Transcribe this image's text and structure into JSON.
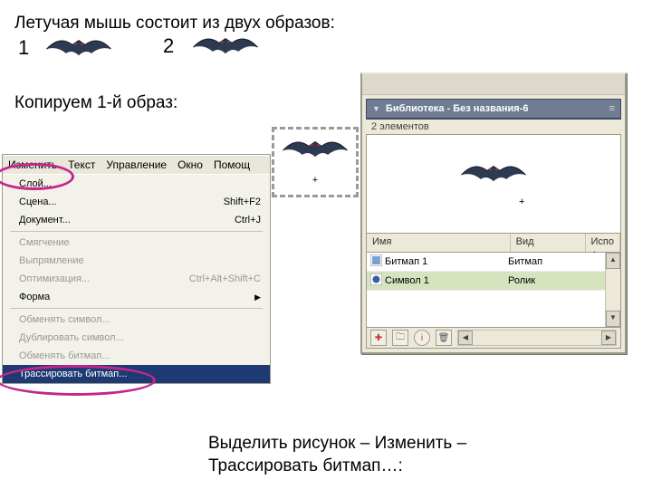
{
  "text": {
    "title_top": "Летучая мышь состоит из двух образов:",
    "num1": "1",
    "num2": "2",
    "copy_line": "Копируем 1-й образ:",
    "bottom1": "Выделить рисунок – Изменить –",
    "bottom2": "Трассировать битмап…:"
  },
  "menubar": {
    "edit": "Изменить",
    "text": "Текст",
    "uprav": "Управление",
    "okno": "Окно",
    "help": "Помощ"
  },
  "dropdown": {
    "sloi": "Слой...",
    "scena": "Сцена...",
    "scena_sc": "Shift+F2",
    "doc": "Документ...",
    "doc_sc": "Ctrl+J",
    "smyag": "Смягчение",
    "vypr": "Выпрямление",
    "opt": "Оптимизация...",
    "opt_sc": "Ctrl+Alt+Shift+C",
    "forma": "Форма",
    "obm_sym": "Обменять символ...",
    "dup_sym": "Дублировать символ...",
    "obm_bit": "Обменять битмап...",
    "trace": "Трассировать битмап..."
  },
  "library": {
    "title": "Библиотека - Без названия-6",
    "count": "2 элементов",
    "col_name": "Имя",
    "col_view": "Вид",
    "col_use": "Испо",
    "row1_name": "Битмап 1",
    "row1_type": "Битмап",
    "row2_name": "Символ 1",
    "row2_type": "Ролик",
    "icon_bitmap_color": "#7aa0d4",
    "icon_symbol_color": "#3a5fa8"
  },
  "colors": {
    "highlight": "#c4268a",
    "menu_sel": "#1d3a74",
    "panel": "#ece9d8",
    "titlebar": "#6f7c93"
  }
}
